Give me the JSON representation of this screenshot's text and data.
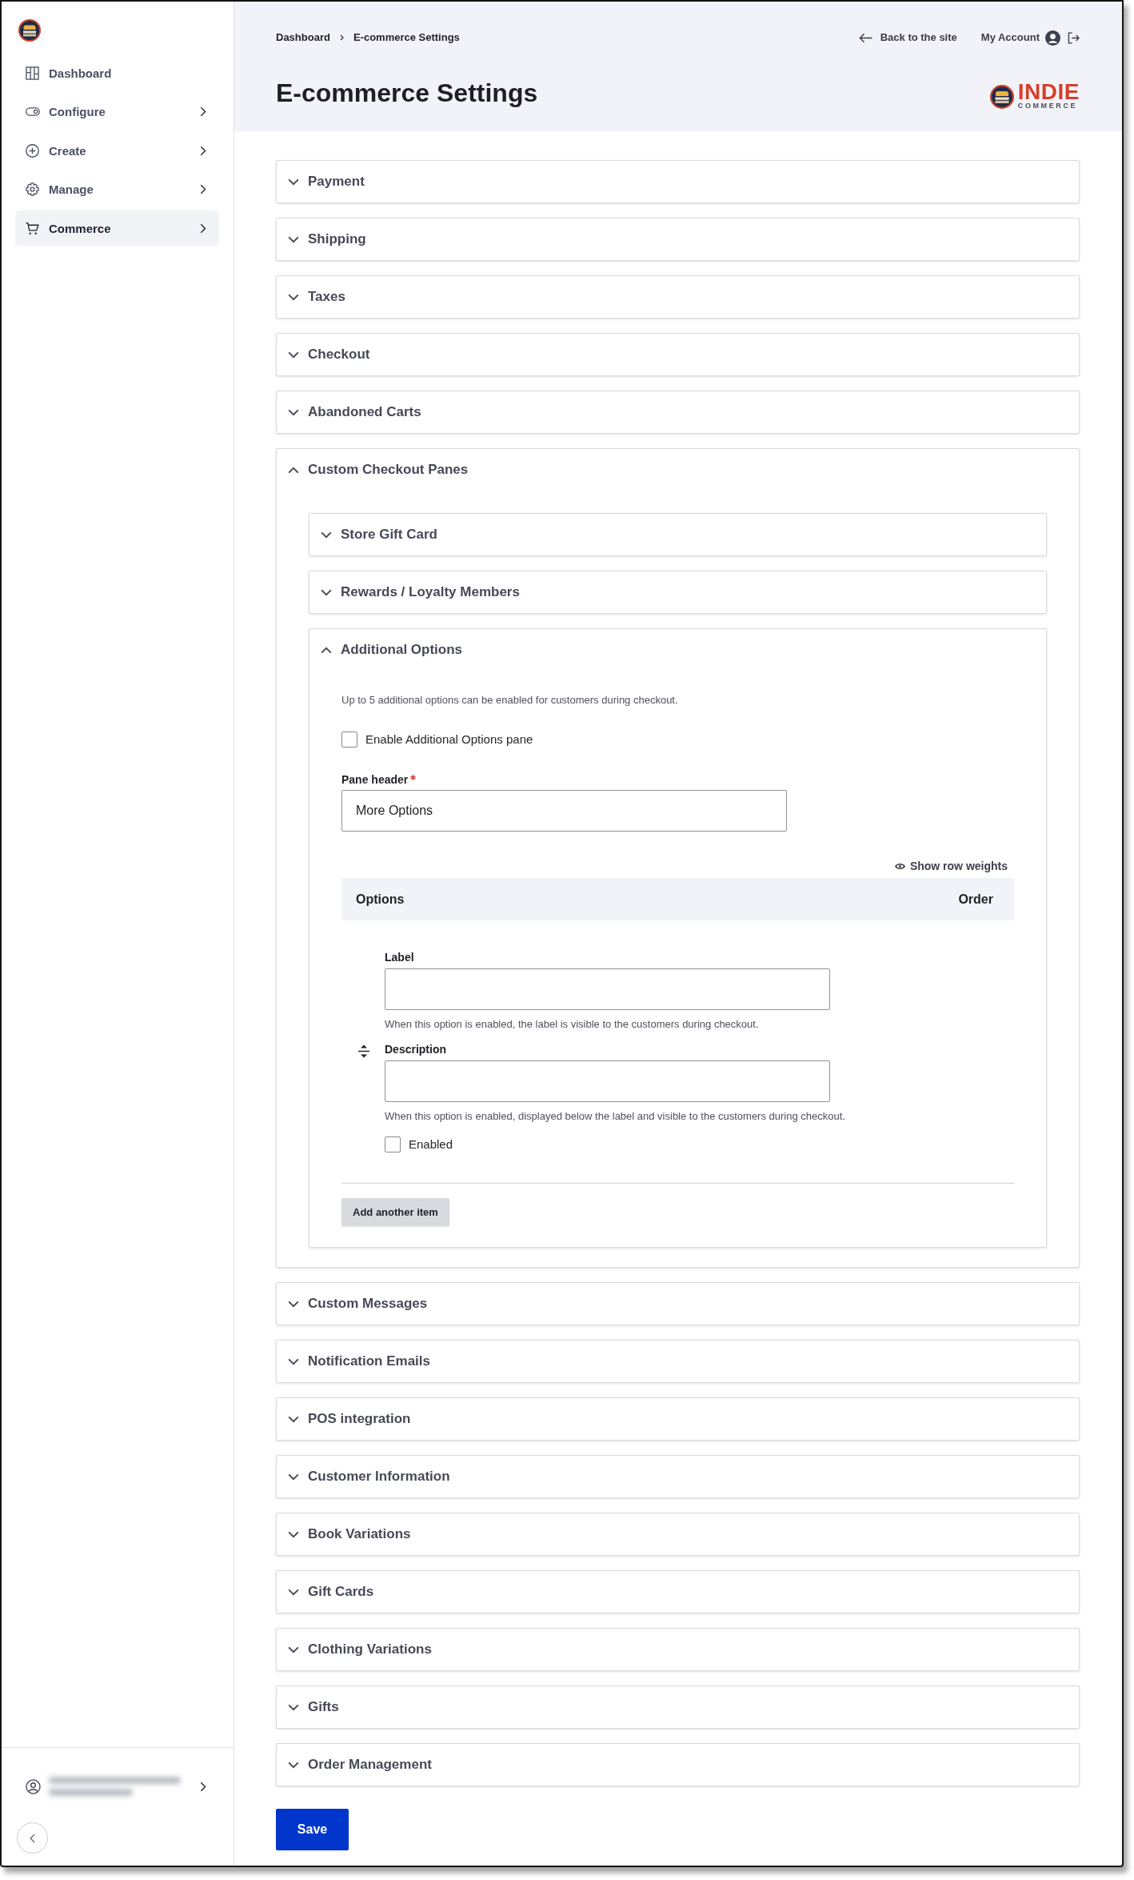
{
  "sidebar": {
    "nav": [
      {
        "label": "Dashboard",
        "expandable": false,
        "selected": false
      },
      {
        "label": "Configure",
        "expandable": true,
        "selected": false
      },
      {
        "label": "Create",
        "expandable": true,
        "selected": false
      },
      {
        "label": "Manage",
        "expandable": true,
        "selected": false
      },
      {
        "label": "Commerce",
        "expandable": true,
        "selected": true
      }
    ]
  },
  "header": {
    "breadcrumb": [
      "Dashboard",
      "E-commerce Settings"
    ],
    "back_link": "Back to the site",
    "account_link": "My Account",
    "title": "E-commerce Settings",
    "logo": {
      "name": "INDIE",
      "tagline": "COMMERCE"
    }
  },
  "sections": [
    {
      "title": "Payment",
      "expanded": false
    },
    {
      "title": "Shipping",
      "expanded": false
    },
    {
      "title": "Taxes",
      "expanded": false
    },
    {
      "title": "Checkout",
      "expanded": false
    },
    {
      "title": "Abandoned Carts",
      "expanded": false
    },
    {
      "title": "Custom Checkout Panes",
      "expanded": true,
      "panes": [
        {
          "title": "Store Gift Card",
          "expanded": false
        },
        {
          "title": "Rewards / Loyalty Members",
          "expanded": false
        },
        {
          "title": "Additional Options",
          "expanded": true,
          "content": {
            "intro": "Up to 5 additional options can be enabled for customers during checkout.",
            "enable_pane": {
              "label": "Enable Additional Options pane",
              "checked": false
            },
            "pane_header": {
              "label": "Pane header",
              "required": true,
              "value": "More Options"
            },
            "row_weights_toggle": "Show row weights",
            "options_table": {
              "columns": [
                "Options",
                "Order"
              ],
              "rows": [
                {
                  "fields": [
                    {
                      "label": "Label",
                      "help": "When this option is enabled, the label is visible to the customers during checkout."
                    },
                    {
                      "label": "Description",
                      "help": "When this option is enabled, displayed below the label and visible to the customers during checkout."
                    }
                  ],
                  "enabled": {
                    "label": "Enabled",
                    "checked": false
                  }
                }
              ]
            },
            "add_button": "Add another item"
          }
        }
      ]
    },
    {
      "title": "Custom Messages",
      "expanded": false
    },
    {
      "title": "Notification Emails",
      "expanded": false
    },
    {
      "title": "POS integration",
      "expanded": false
    },
    {
      "title": "Customer Information",
      "expanded": false
    },
    {
      "title": "Book Variations",
      "expanded": false
    },
    {
      "title": "Gift Cards",
      "expanded": false
    },
    {
      "title": "Clothing Variations",
      "expanded": false
    },
    {
      "title": "Gifts",
      "expanded": false
    },
    {
      "title": "Order Management",
      "expanded": false
    }
  ],
  "save_button": "Save"
}
